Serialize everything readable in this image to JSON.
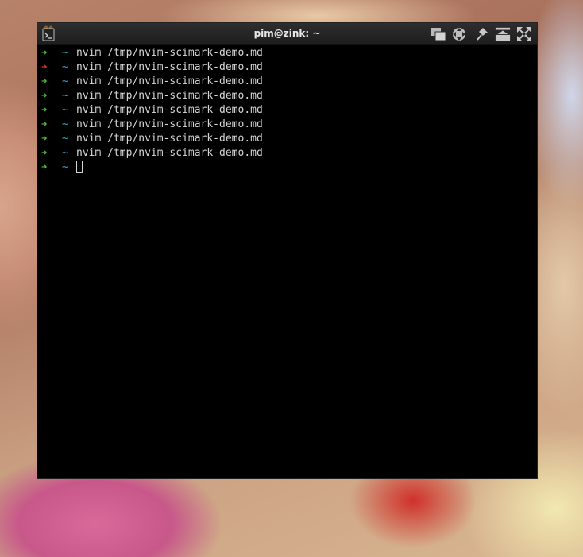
{
  "window": {
    "title": "pim@zink: ~"
  },
  "titlebar_buttons": [
    {
      "icon": "windows-icon"
    },
    {
      "icon": "move-icon"
    },
    {
      "icon": "pin-icon"
    },
    {
      "icon": "shade-icon"
    },
    {
      "icon": "fullscreen-icon"
    }
  ],
  "terminal": {
    "prompt_arrow": "➜",
    "prompt_dir": "~",
    "history": [
      {
        "status": "ok",
        "command": "nvim /tmp/nvim-scimark-demo.md"
      },
      {
        "status": "err",
        "command": "nvim /tmp/nvim-scimark-demo.md"
      },
      {
        "status": "ok",
        "command": "nvim /tmp/nvim-scimark-demo.md"
      },
      {
        "status": "ok",
        "command": "nvim /tmp/nvim-scimark-demo.md"
      },
      {
        "status": "ok",
        "command": "nvim /tmp/nvim-scimark-demo.md"
      },
      {
        "status": "ok",
        "command": "nvim /tmp/nvim-scimark-demo.md"
      },
      {
        "status": "ok",
        "command": "nvim /tmp/nvim-scimark-demo.md"
      },
      {
        "status": "ok",
        "command": "nvim /tmp/nvim-scimark-demo.md"
      }
    ],
    "current_input": ""
  },
  "colors": {
    "ok_arrow": "#4ec23b",
    "err_arrow": "#e0372f",
    "dir": "#2fa7c9",
    "text": "#d6d6d6",
    "background": "#000000"
  }
}
